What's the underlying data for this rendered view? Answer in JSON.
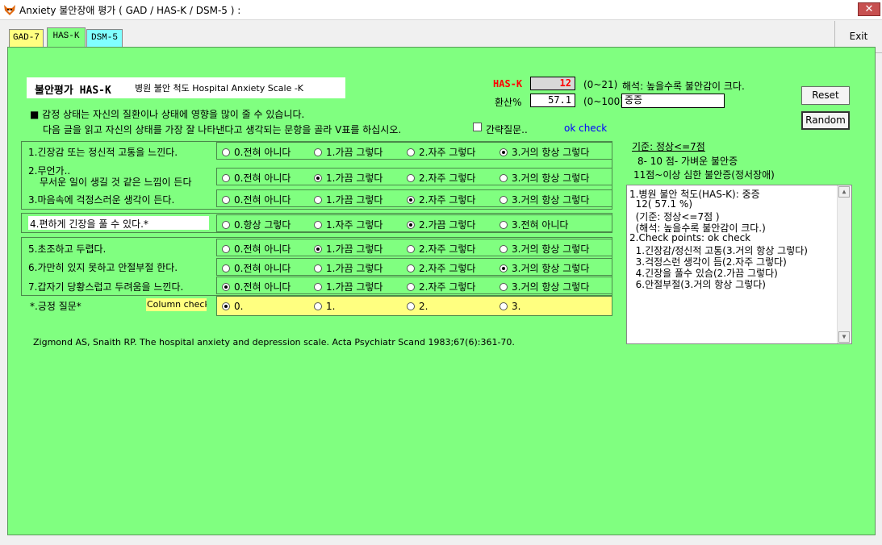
{
  "window": {
    "title": "Anxiety 불안장애 평가 ( GAD / HAS-K / DSM-5 ) :",
    "close_label": "✕"
  },
  "tabs": [
    {
      "label": "GAD-7",
      "color": "#ffff80"
    },
    {
      "label": "HAS-K",
      "color": "#80ff80"
    },
    {
      "label": "DSM-5",
      "color": "#80ffff"
    }
  ],
  "exit_label": "Exit",
  "heading": {
    "title": "불안평가 HAS-K",
    "subtitle": "병원 불안 척도 Hospital Anxiety Scale -K"
  },
  "score": {
    "label": "HAS-K",
    "value": "12",
    "range": "(0~21)",
    "interpretation": "해석: 높을수록 불안감이 크다."
  },
  "converted": {
    "label": "환산%",
    "value": "57.1",
    "range": "(0~100)",
    "severity": "중증"
  },
  "buttons": {
    "reset": "Reset",
    "random": "Random"
  },
  "instructions": {
    "line1": "■ 감정 상태는 자신의 질환이나 상태에 영향을 많이 줄 수 있습니다.",
    "line2": "다음 글을 읽고 자신의 상태를 가장 잘 나타낸다고 생각되는 문항을 골라 V표를 하십시오.",
    "brief_checkbox": "간략질문..",
    "ok_check": "ok check"
  },
  "criteria": {
    "title": "기준: 정상<=7점",
    "line1": "8- 10 점- 가벼운 불안증",
    "line2": "11점~이상  심한 불안증(정서장애)"
  },
  "questions": [
    {
      "label": "1.긴장감 또는 정신적 고통을 느낀다.",
      "options": [
        "0.전혀 아니다",
        "1.가끔 그렇다",
        "2.자주 그렇다",
        "3.거의 항상 그렇다"
      ],
      "selected": 3
    },
    {
      "label": "2.무언가..",
      "label2": "무서운 일이 생길 것 같은 느낌이 든다",
      "options": [
        "0.전혀 아니다",
        "1.가끔 그렇다",
        "2.자주 그렇다",
        "3.거의 항상 그렇다"
      ],
      "selected": 1
    },
    {
      "label": "3.마음속에 걱정스러운 생각이 든다.",
      "options": [
        "0.전혀 아니다",
        "1.가끔 그렇다",
        "2.자주 그렇다",
        "3.거의 항상 그렇다"
      ],
      "selected": 2
    },
    {
      "label": "4.편하게 긴장을 풀 수 있다.*",
      "options": [
        "0.항상 그렇다",
        "1.자주 그렇다",
        "2.가끔 그렇다",
        "3.전혀 아니다"
      ],
      "selected": 2
    },
    {
      "label": "5.초조하고 두렵다.",
      "options": [
        "0.전혀 아니다",
        "1.가끔 그렇다",
        "2.자주 그렇다",
        "3.거의 항상 그렇다"
      ],
      "selected": 1
    },
    {
      "label": "6.가만히 있지 못하고 안절부절 한다.",
      "options": [
        "0.전혀 아니다",
        "1.가끔 그렇다",
        "2.자주 그렇다",
        "3.거의 항상 그렇다"
      ],
      "selected": 3
    },
    {
      "label": "7.갑자기 당황스럽고 두려움을 느낀다.",
      "options": [
        "0.전혀 아니다",
        "1.가끔 그렇다",
        "2.자주 그렇다",
        "3.거의 항상 그렇다"
      ],
      "selected": 0
    }
  ],
  "positive_row": {
    "label": "*.긍정 질문*",
    "column_check": "Column check",
    "options": [
      "0.",
      "1.",
      "2.",
      "3."
    ],
    "selected": 0
  },
  "reference": "Zigmond AS, Snaith RP. The hospital anxiety and depression scale. Acta Psychiatr Scand 1983;67(6):361-70.",
  "result_lines": [
    "1.병원 불안 척도(HAS-K): 중증",
    "  12( 57.1 %)",
    "  (기준: 정상<=7점 )",
    "  (해석: 높을수록 불안감이 크다.)",
    "2.Check points: ok check",
    "  1.긴장감/정신적 고통(3.거의 항상 그렇다)",
    "  3.걱정스런 생각이 듬(2.자주 그렇다)",
    "  4.긴장을 풀수 있슴(2.가끔 그렇다)",
    "  6.안절부절(3.거의 항상 그렇다)"
  ]
}
